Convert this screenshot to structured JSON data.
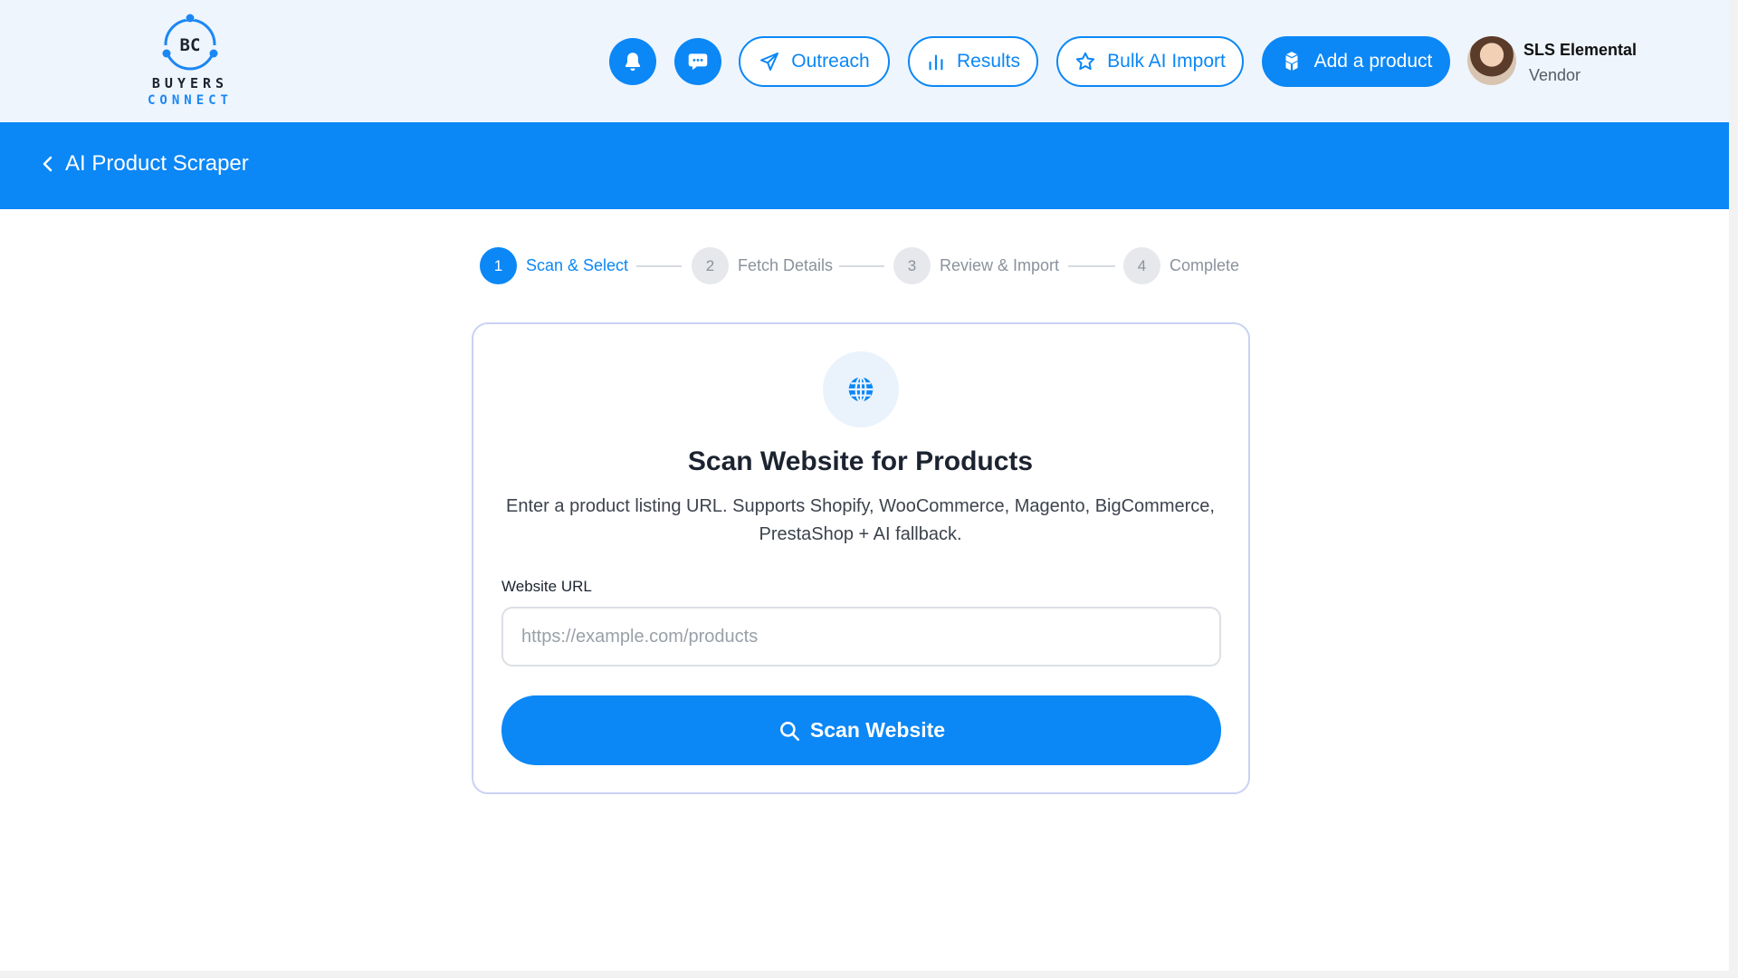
{
  "brand": {
    "monogram": "BC",
    "word1": "BUYERS",
    "word2": "CONNECT"
  },
  "header": {
    "nav": {
      "outreach_label": "Outreach",
      "results_label": "Results",
      "bulk_import_label": "Bulk AI Import",
      "add_product_label": "Add a product"
    },
    "user": {
      "name": "SLS Elemental",
      "role": "Vendor"
    }
  },
  "page_header": {
    "title": "AI Product Scraper"
  },
  "stepper": {
    "steps": [
      {
        "number": "1",
        "label": "Scan & Select",
        "state": "active"
      },
      {
        "number": "2",
        "label": "Fetch Details",
        "state": "inactive"
      },
      {
        "number": "3",
        "label": "Review & Import",
        "state": "inactive"
      },
      {
        "number": "4",
        "label": "Complete",
        "state": "inactive"
      }
    ]
  },
  "scan_card": {
    "icon": "globe-icon",
    "title": "Scan Website for Products",
    "description": "Enter a product listing URL. Supports Shopify, WooCommerce, Magento, BigCommerce, PrestaShop + AI fallback.",
    "url_label": "Website URL",
    "url_value": "",
    "url_placeholder": "https://example.com/products",
    "scan_button_label": "Scan Website"
  },
  "colors": {
    "primary": "#0b87f6",
    "header_bg": "#eef5fd",
    "card_border": "#c9d2f3",
    "inactive_step": "#e6e8ec"
  }
}
